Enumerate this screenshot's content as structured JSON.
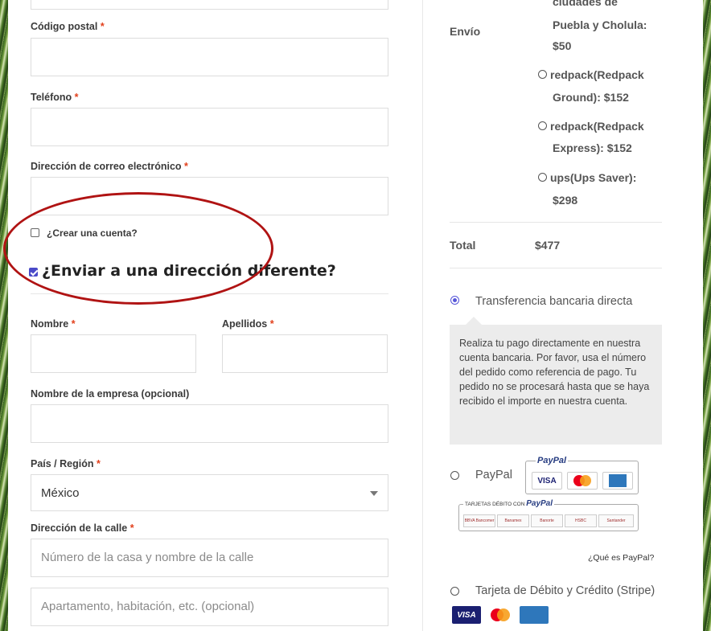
{
  "form": {
    "postal_label": "Código postal",
    "phone_label": "Teléfono",
    "email_label": "Dirección de correo electrónico",
    "required_mark": "*",
    "create_account_label": "¿Crear una cuenta?",
    "ship_different_label": "¿Enviar a una dirección diferente?",
    "first_name_label": "Nombre",
    "last_name_label": "Apellidos",
    "company_label": "Nombre de la empresa (opcional)",
    "country_label": "País / Región",
    "country_value": "México",
    "street_label": "Dirección de la calle",
    "street_placeholder": "Número de la casa y nombre de la calle",
    "apartment_placeholder": "Apartamento, habitación, etc. (opcional)"
  },
  "summary": {
    "shipping_label": "Envío",
    "shipping_partial_1": "ciudades de",
    "shipping_partial_2": "Puebla y Cholula:",
    "shipping_partial_3": "$50",
    "options": [
      {
        "line1": "redpack(Redpack",
        "line2": "Ground): $152"
      },
      {
        "line1": "redpack(Redpack",
        "line2": "Express): $152"
      },
      {
        "line1": "ups(Ups Saver):",
        "line2": "$298"
      }
    ],
    "total_label": "Total",
    "total_value": "$477"
  },
  "payment": {
    "bank_transfer_label": "Transferencia bancaria directa",
    "bank_transfer_info": "Realiza tu pago directamente en nuestra cuenta bancaria. Por favor, usa el número del pedido como referencia de pago. Tu pedido no se procesará hasta que se haya recibido el importe en nuestra cuenta.",
    "paypal_label": "PayPal",
    "paypal_logo": "PayPal",
    "paypal_debit_caption": "TARJETAS DÉBITO CON",
    "what_is_paypal": "¿Qué es PayPal?",
    "stripe_label": "Tarjeta de Débito y Crédito (Stripe)",
    "card_visa": "VISA",
    "bank_logos": [
      "BBVA Bancomer",
      "Banamex",
      "Banorte",
      "HSBC",
      "Santander"
    ]
  },
  "colors": {
    "annotation_red": "#b01313",
    "accent": "#5656d8",
    "required": "#e2401c"
  }
}
